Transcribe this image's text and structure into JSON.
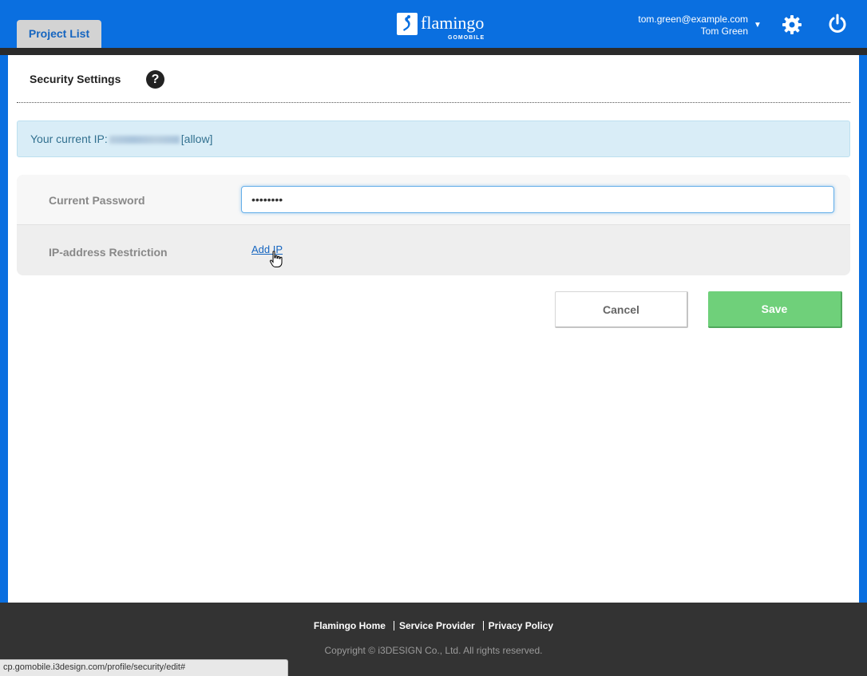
{
  "header": {
    "tab_label": "Project List",
    "logo_text": "flamingo",
    "logo_sub": "GOMOBILE",
    "user_email": "tom.green@example.com",
    "user_name": "Tom Green",
    "caret": "▼",
    "settings_icon": "gear-icon",
    "power_icon": "power-icon"
  },
  "page": {
    "title": "Security Settings",
    "help_glyph": "?"
  },
  "ip_notice": {
    "prefix": "Your current IP:",
    "suffix": "[allow]"
  },
  "form": {
    "password_label": "Current Password",
    "password_value": "••••••••",
    "ip_label": "IP-address Restriction",
    "add_ip_link": "Add IP"
  },
  "actions": {
    "cancel_label": "Cancel",
    "save_label": "Save"
  },
  "footer": {
    "links": [
      "Flamingo Home",
      "Service Provider",
      "Privacy Policy"
    ],
    "copyright": "Copyright © i3DESIGN Co., Ltd. All rights reserved."
  },
  "status_bar": {
    "url": "cp.gomobile.i3design.com/profile/security/edit#"
  },
  "colors": {
    "brand_blue": "#0a6fe0",
    "save_green": "#6fd07a",
    "notice_bg": "#d9edf7",
    "footer_bg": "#333333"
  }
}
